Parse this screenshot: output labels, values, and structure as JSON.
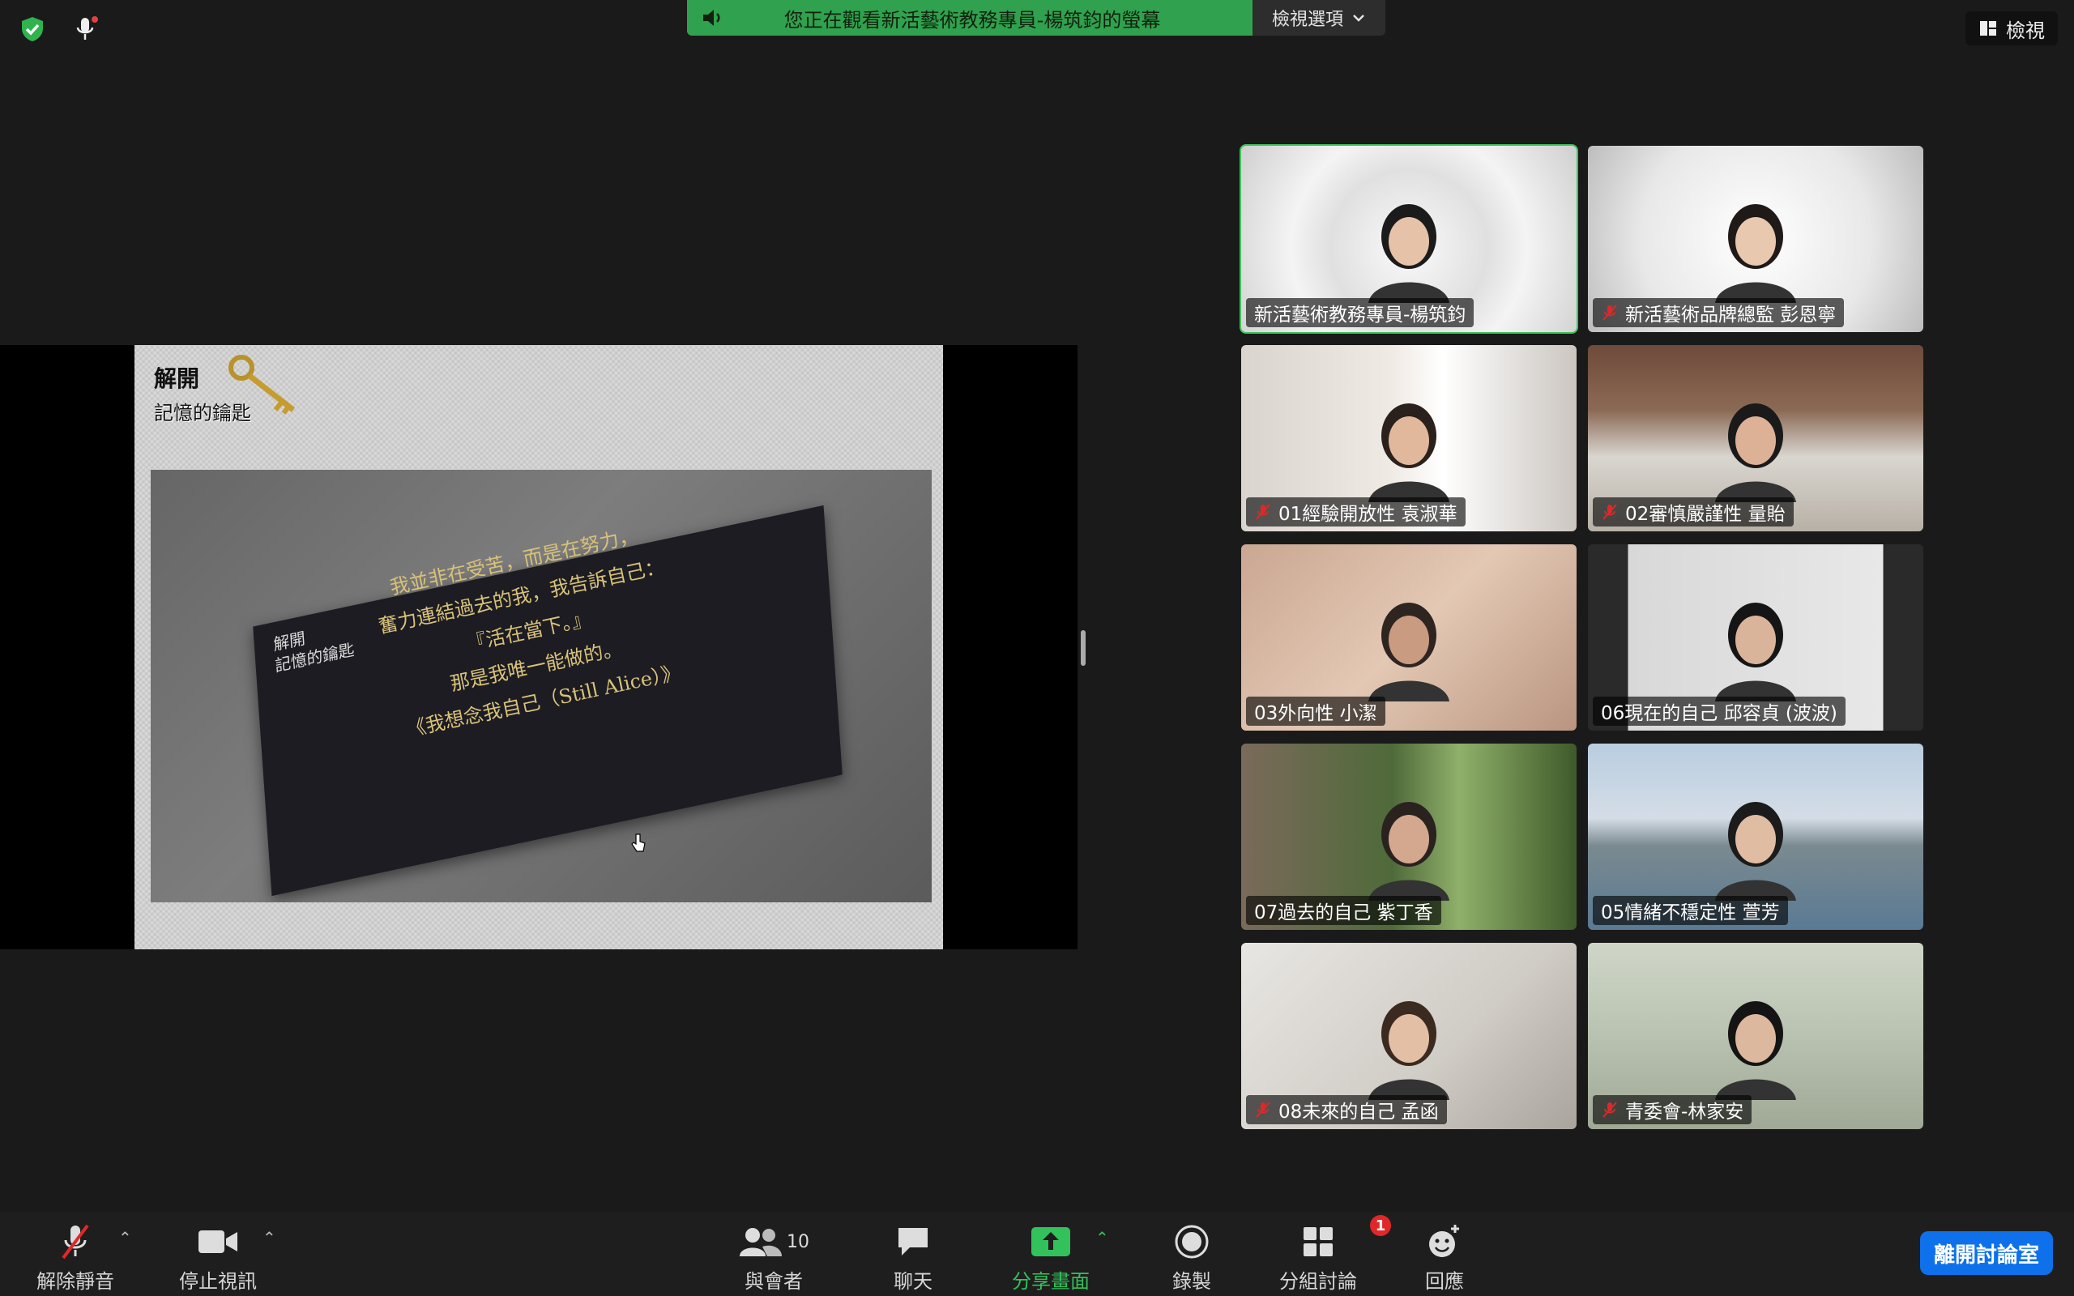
{
  "banner": {
    "text": "您正在觀看新活藝術教務專員-楊筑鈞的螢幕",
    "view_options": "檢視選項"
  },
  "view_button": "檢視",
  "slide": {
    "logo_line1": "解開",
    "logo_line2": "記憶的鑰匙",
    "card_logo_line1": "解開",
    "card_logo_line2": "記憶的鑰匙",
    "poem": [
      "我並非在受苦，而是在努力，",
      "奮力連結過去的我，我告訴自己：",
      "『活在當下。』",
      "那是我唯一能做的。",
      "《我想念我自己（Still Alice）》"
    ]
  },
  "participants": [
    {
      "name": "新活藝術教務專員-楊筑鈞",
      "muted": false,
      "active": true
    },
    {
      "name": "新活藝術品牌總監 彭恩寧",
      "muted": true,
      "active": false
    },
    {
      "name": "01經驗開放性 袁淑華",
      "muted": true,
      "active": false
    },
    {
      "name": "02審慎嚴謹性 量貽",
      "muted": true,
      "active": false
    },
    {
      "name": "03外向性 小潔",
      "muted": false,
      "active": false
    },
    {
      "name": "06現在的自己 邱容貞 (波波)",
      "muted": false,
      "active": false
    },
    {
      "name": "07過去的自己 紫丁香",
      "muted": false,
      "active": false
    },
    {
      "name": "05情緒不穩定性 萱芳",
      "muted": false,
      "active": false
    },
    {
      "name": "08未來的自己 孟函",
      "muted": true,
      "active": false
    },
    {
      "name": "青委會-林家安",
      "muted": true,
      "active": false
    }
  ],
  "toolbar": {
    "unmute": "解除靜音",
    "stop_video": "停止視訊",
    "participants": "與會者",
    "participants_count": "10",
    "chat": "聊天",
    "share_screen": "分享畫面",
    "record": "錄製",
    "breakout": "分組討論",
    "breakout_badge": "1",
    "reactions": "回應",
    "leave": "離開討論室"
  },
  "colors": {
    "banner_green": "#30a14e",
    "accent_green": "#33c15b",
    "leave_blue": "#0e71eb",
    "badge_red": "#e02828"
  }
}
